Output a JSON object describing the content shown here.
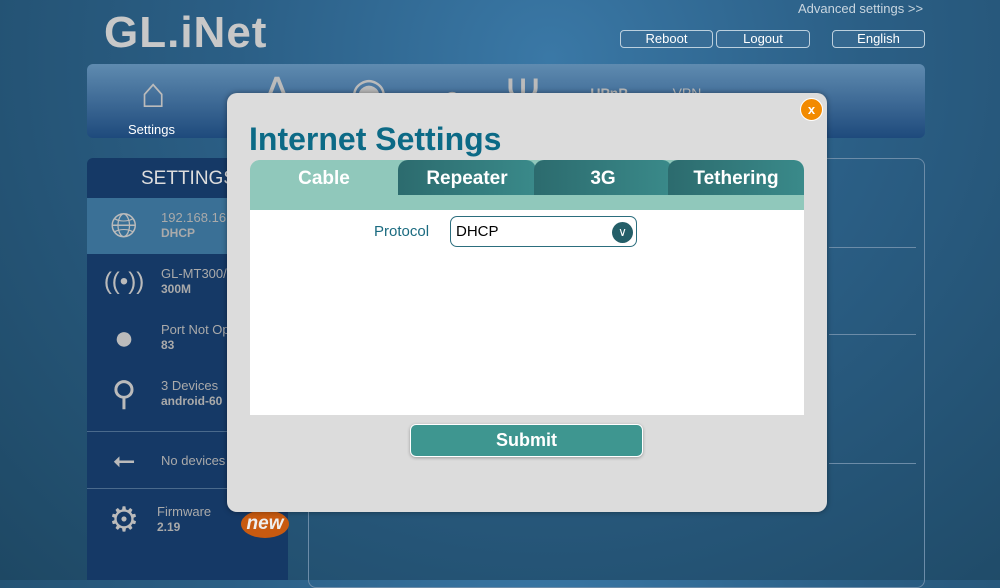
{
  "header": {
    "logo": "GL.iNet",
    "advanced": "Advanced settings >>",
    "reboot": "Reboot",
    "logout": "Logout",
    "language": "English"
  },
  "nav": {
    "settings_label": "Settings"
  },
  "sidebar": {
    "title": "SETTINGS",
    "items": [
      {
        "line1": "192.168.16",
        "line2": "DHCP"
      },
      {
        "line1": "GL-MT300/",
        "line2": "300M"
      },
      {
        "line1": "Port Not Op",
        "line2": "83"
      },
      {
        "line1": "3 Devices",
        "line2": "android-60"
      },
      {
        "line1": "No devices",
        "line2": ""
      },
      {
        "line1": "Firmware",
        "line2": "2.19"
      }
    ],
    "new_badge": "new"
  },
  "modal": {
    "title": "Internet Settings",
    "close": "x",
    "tabs": [
      "Cable",
      "Repeater",
      "3G",
      "Tethering"
    ],
    "active_tab": "Cable",
    "protocol_label": "Protocol",
    "protocol_value": "DHCP",
    "submit": "Submit"
  },
  "colors": {
    "accent": "#0c6a86",
    "close": "#f28a00",
    "submit": "#3e9690",
    "badge": "#c85a10"
  }
}
